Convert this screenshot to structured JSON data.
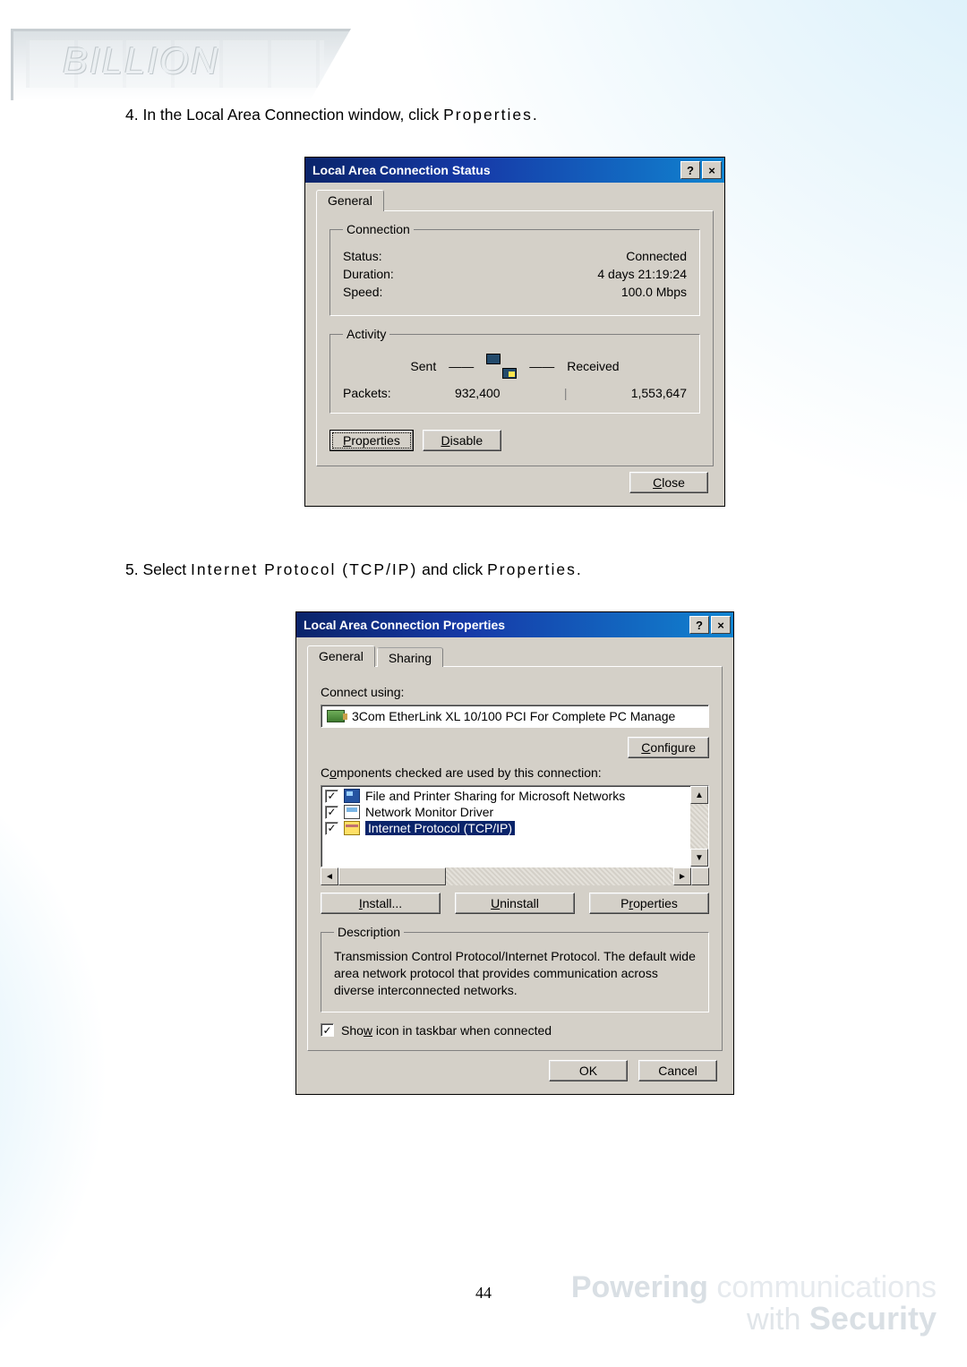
{
  "page_number": "44",
  "logo_text": "BILLION",
  "footer": {
    "line1_strong": "Powering",
    "line1_light": " communications",
    "line2_pre": "with ",
    "line2_strong": "Security"
  },
  "step4": {
    "prefix": "4. In the Local Area Connection window, click ",
    "keyword": "Properties",
    "suffix": "."
  },
  "step5": {
    "prefix": "5. Select ",
    "kw1": "Internet Protocol (TCP/IP)",
    "mid": " and click ",
    "kw2": "Properties",
    "suffix": "."
  },
  "dlg_status": {
    "title": "Local Area Connection Status",
    "help_glyph": "?",
    "close_glyph": "×",
    "tab_general": "General",
    "grp_connection": "Connection",
    "status_label": "Status:",
    "status_value": "Connected",
    "duration_label": "Duration:",
    "duration_value": "4 days 21:19:24",
    "speed_label": "Speed:",
    "speed_value": "100.0 Mbps",
    "grp_activity": "Activity",
    "sent_label": "Sent",
    "received_label": "Received",
    "packets_label": "Packets:",
    "packets_sent": "932,400",
    "packets_recv": "1,553,647",
    "btn_properties": "Properties",
    "btn_disable": "Disable",
    "btn_close": "Close"
  },
  "dlg_props": {
    "title": "Local Area Connection Properties",
    "help_glyph": "?",
    "close_glyph": "×",
    "tab_general": "General",
    "tab_sharing": "Sharing",
    "connect_using_label": "Connect using:",
    "adapter_name": "3Com EtherLink XL 10/100 PCI For Complete PC Manage",
    "btn_configure": "Configure",
    "components_label": "Components checked are used by this connection:",
    "items": [
      {
        "label": "File and Printer Sharing for Microsoft Networks",
        "checked": true,
        "icon": "svc-share",
        "selected": false
      },
      {
        "label": "Network Monitor Driver",
        "checked": true,
        "icon": "svc-mon",
        "selected": false
      },
      {
        "label": "Internet Protocol (TCP/IP)",
        "checked": true,
        "icon": "svc-tcp",
        "selected": true
      }
    ],
    "btn_install": "Install...",
    "btn_uninstall": "Uninstall",
    "btn_properties": "Properties",
    "grp_description": "Description",
    "description_text": "Transmission Control Protocol/Internet Protocol. The default wide area network protocol that provides communication across diverse interconnected networks.",
    "show_icon_label": "Show icon in taskbar when connected",
    "show_icon_checked": true,
    "btn_ok": "OK",
    "btn_cancel": "Cancel",
    "scroll_up": "▲",
    "scroll_down": "▼",
    "scroll_left": "◄",
    "scroll_right": "►"
  },
  "underline_map": {
    "Properties_P": "P",
    "Disable_D": "D",
    "Close_C": "C",
    "Configure_C": "C",
    "Components_o": "o",
    "Install_I": "I",
    "Uninstall_U": "U",
    "Properties_r": "r",
    "Show_w": "w"
  }
}
